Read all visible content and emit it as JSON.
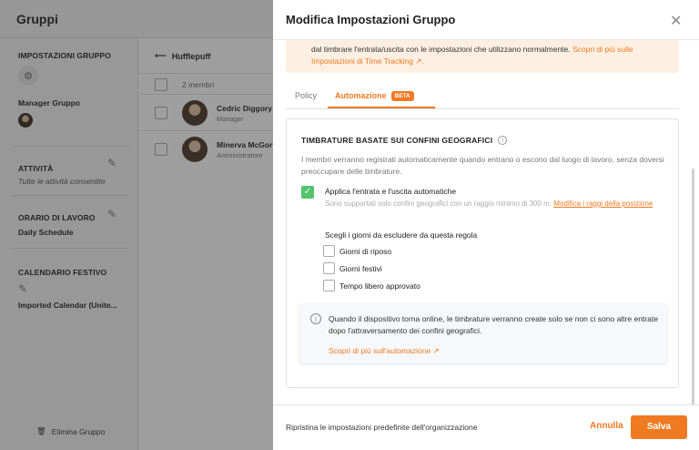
{
  "app": {
    "title": "Gruppi",
    "settings_title": "IMPOSTAZIONI GRUPPO",
    "manager_label": "Manager Gruppo",
    "activities_title": "ATTIVITÀ",
    "activities_value": "Tutte le attività consentite",
    "schedule_title": "ORARIO DI LAVORO",
    "schedule_value": "Daily Schedule",
    "holiday_title": "CALENDARIO FESTIVO",
    "holiday_value": "Imported Calendar (Unite...",
    "delete_label": "Elimina Gruppo",
    "group_name": "Hufflepuff",
    "member_count": "2 membri",
    "members": [
      {
        "name": "Cedric Diggory",
        "role": "Manager"
      },
      {
        "name": "Minerva McGor",
        "role": "Amministratore"
      }
    ]
  },
  "drawer": {
    "title": "Modifica Impostazioni Gruppo",
    "notice_text": "dal timbrare l'entrata/uscita con le impostazioni che utilizzano normalmente.",
    "notice_link": "Scopri di più sulle Impostazioni di Time Tracking ↗.",
    "tabs": [
      {
        "label": "Policy"
      },
      {
        "label": "Automazione"
      }
    ],
    "beta_badge": "BETA",
    "card": {
      "title": "TIMBRATURE BASATE SUI CONFINI GEOGRAFICI",
      "description": "I membri verranno registrati automaticamente quando entrano o escono dal luogo di lavoro, senza doversi preoccupare delle timbrature.",
      "option_label": "Applica l'entrata e l'uscita automatiche",
      "option_help": "Sono supportati solo confini geografici con un raggio minimo di 300 m.",
      "option_link": "Modifica i raggi della posizione",
      "exclude_title": "Scegli i giorni da escludere da questa regola",
      "days": [
        {
          "label": "Giorni di riposo",
          "checked": false
        },
        {
          "label": "Giorni festivi",
          "checked": false
        },
        {
          "label": "Tempo libero approvato",
          "checked": false
        }
      ],
      "info_text": "Quando il dispositivo torna online, le timbrature verranno create solo se non ci sono altre entrate dopo l'attraversamento dei confini geografici.",
      "info_link": "Scopri di più sull'automazione ↗"
    },
    "footer": {
      "reset_label": "Ripristina le impostazioni predefinite dell'organizzazione",
      "cancel_label": "Annulla",
      "save_label": "Salva"
    }
  },
  "colors": {
    "accent": "#f07a22",
    "check": "#52c46b",
    "notice_bg": "#fdf0e3"
  }
}
